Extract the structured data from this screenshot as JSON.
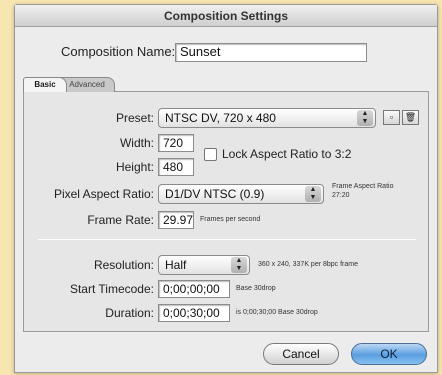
{
  "window": {
    "title": "Composition Settings"
  },
  "composition_name": {
    "label": "Composition Name:",
    "value": "Sunset"
  },
  "tabs": [
    {
      "label": "Basic",
      "active": true
    },
    {
      "label": "Advanced",
      "active": false
    }
  ],
  "basic": {
    "preset": {
      "label": "Preset:",
      "value": "NTSC DV, 720 x 480",
      "icons": [
        "save-preset-icon",
        "trash-icon"
      ]
    },
    "width": {
      "label": "Width:",
      "value": "720"
    },
    "height": {
      "label": "Height:",
      "value": "480"
    },
    "lock_aspect": {
      "label": "Lock Aspect Ratio to 3:2",
      "checked": false
    },
    "pixel_aspect": {
      "label": "Pixel Aspect Ratio:",
      "value": "D1/DV NTSC (0.9)",
      "frame_aspect_label": "Frame Aspect Ratio",
      "frame_aspect_value": "27:20"
    },
    "frame_rate": {
      "label": "Frame Rate:",
      "value": "29.97",
      "unit": "Frames per second"
    },
    "resolution": {
      "label": "Resolution:",
      "value": "Half",
      "info": "360 x 240, 337K per 8bpc frame"
    },
    "start_timecode": {
      "label": "Start Timecode:",
      "value": "0;00;00;00",
      "note": "Base 30drop"
    },
    "duration": {
      "label": "Duration:",
      "value": "0;00;30;00",
      "note": "is 0;00;30;00  Base 30drop"
    }
  },
  "buttons": {
    "cancel": "Cancel",
    "ok": "OK"
  }
}
